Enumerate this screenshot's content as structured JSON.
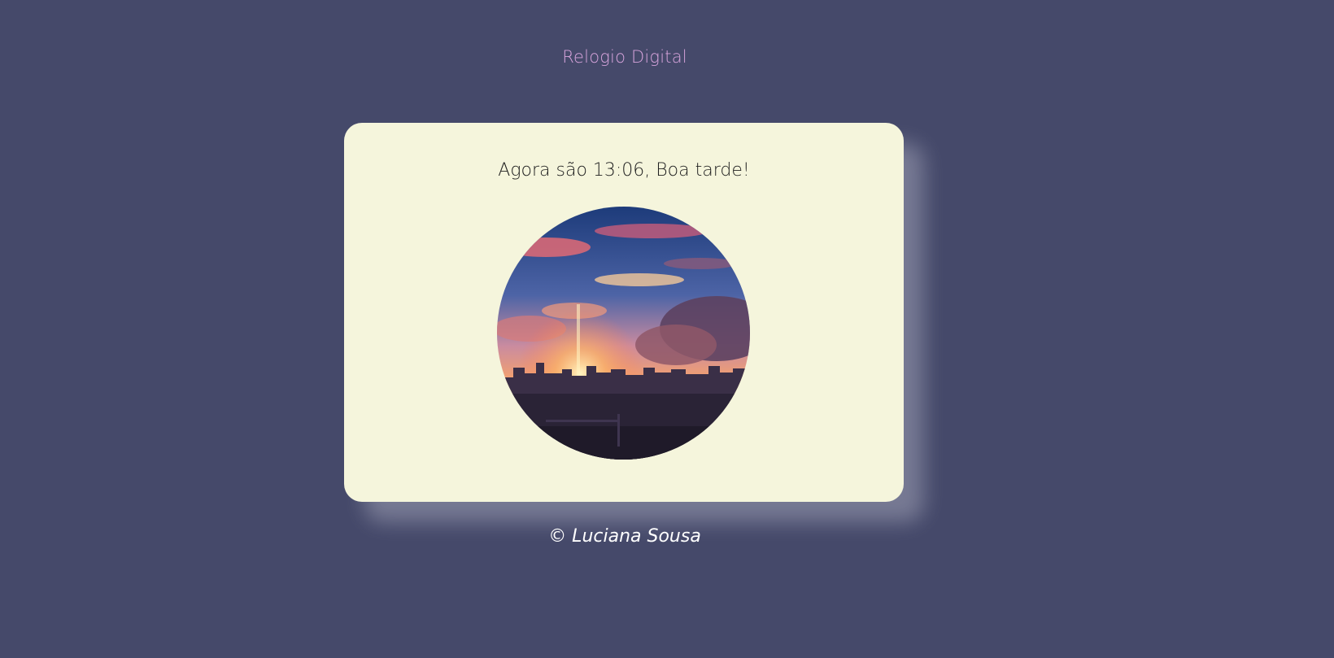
{
  "header": {
    "title": "Relogio Digital"
  },
  "card": {
    "greeting": "Agora são 13:06, Boa tarde!",
    "image": "sunset-city-skyline"
  },
  "footer": {
    "text": "© Luciana Sousa"
  },
  "colors": {
    "background": "#45496a",
    "card": "#f5f5dc",
    "title": "#d7a4dc",
    "footer_text": "#ffffff"
  }
}
